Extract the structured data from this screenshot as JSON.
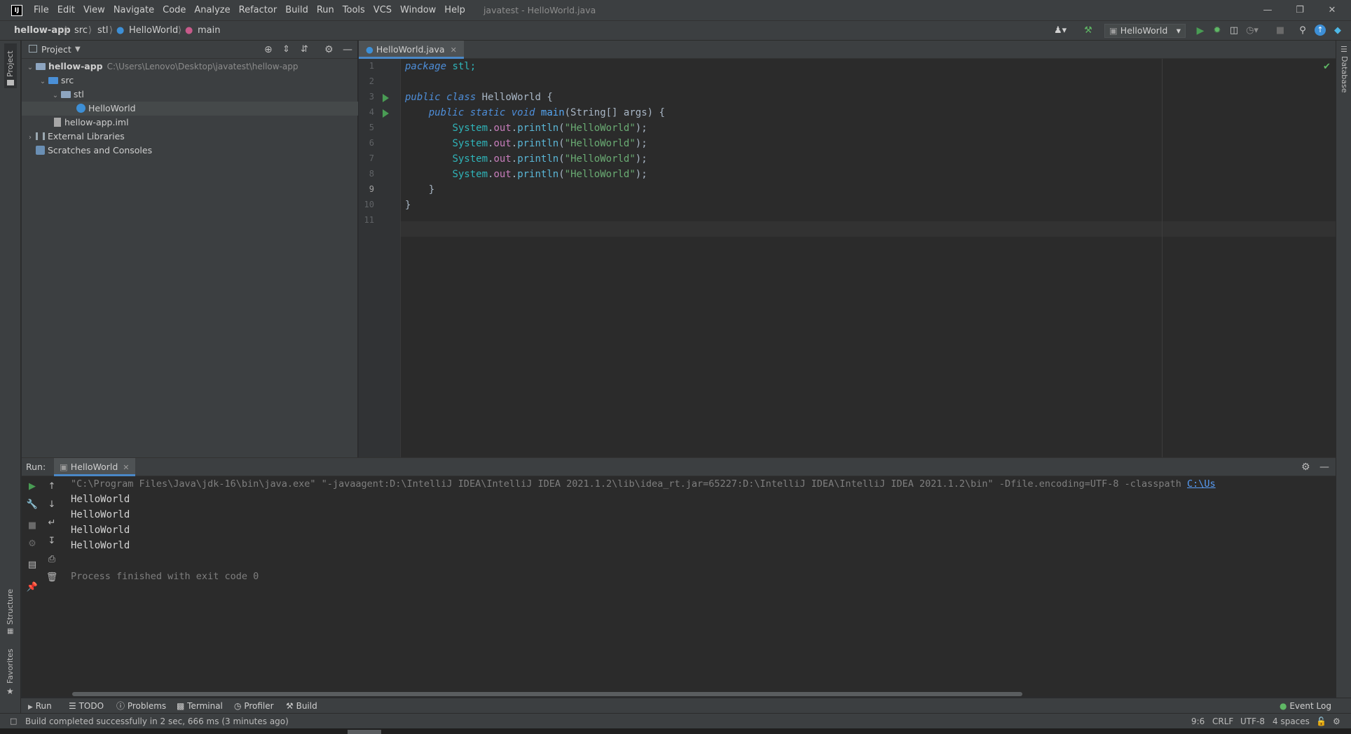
{
  "window": {
    "title": "javatest - HelloWorld.java",
    "menu": [
      "File",
      "Edit",
      "View",
      "Navigate",
      "Code",
      "Analyze",
      "Refactor",
      "Build",
      "Run",
      "Tools",
      "VCS",
      "Window",
      "Help"
    ]
  },
  "breadcrumb": {
    "project": "hellow-app",
    "src": "src",
    "pkg": "stl",
    "cls": "HelloWorld",
    "method": "main",
    "run_config": "HelloWorld"
  },
  "side": {
    "project_label": "Project",
    "structure_label": "Structure",
    "favorites_label": "Favorites",
    "database_label": "Database"
  },
  "project_panel": {
    "title": "Project",
    "tree": [
      {
        "label": "hellow-app",
        "path": "C:\\Users\\Lenovo\\Desktop\\javatest\\hellow-app"
      },
      {
        "label": "src"
      },
      {
        "label": "stl"
      },
      {
        "label": "HelloWorld"
      },
      {
        "label": "hellow-app.iml"
      },
      {
        "label": "External Libraries"
      },
      {
        "label": "Scratches and Consoles"
      }
    ]
  },
  "editor": {
    "tab": "HelloWorld.java",
    "line_numbers": [
      "1",
      "2",
      "3",
      "4",
      "5",
      "6",
      "7",
      "8",
      "9",
      "10",
      "11"
    ],
    "code": {
      "l1_kw": "package",
      "l1_rest": " stl;",
      "l3_kw1": "public",
      "l3_kw2": "class",
      "l3_rest": " HelloWorld {",
      "l4_kw1": "public",
      "l4_kw2": "static",
      "l4_kw3": "void",
      "l4_fn": "main",
      "l4_rest": "(String[] args) {",
      "sys": "System",
      "dot1": ".",
      "out": "out",
      "dot2": ".",
      "println": "println",
      "paren_open": "(",
      "str": "\"HelloWorld\"",
      "paren_close": ");",
      "l9": "    }",
      "l10": "}"
    }
  },
  "run_panel": {
    "label": "Run:",
    "tab": "HelloWorld",
    "command": "\"C:\\Program Files\\Java\\jdk-16\\bin\\java.exe\" \"-javaagent:D:\\IntelliJ IDEA\\IntelliJ IDEA 2021.1.2\\lib\\idea_rt.jar=65227:D:\\IntelliJ IDEA\\IntelliJ IDEA 2021.1.2\\bin\" -Dfile.encoding=UTF-8 -classpath",
    "command_link": "C:\\Us",
    "output": [
      "HelloWorld",
      "HelloWorld",
      "HelloWorld",
      "HelloWorld"
    ],
    "exit": "Process finished with exit code 0"
  },
  "bottom_tabs": [
    "Run",
    "TODO",
    "Problems",
    "Terminal",
    "Profiler",
    "Build"
  ],
  "event_log": "Event Log",
  "status": {
    "message": "Build completed successfully in 2 sec, 666 ms (3 minutes ago)",
    "position": "9:6",
    "line_sep": "CRLF",
    "encoding": "UTF-8",
    "indent": "4 spaces"
  },
  "colors": {
    "keyword": "#4e8ed9",
    "string": "#6aab73",
    "field": "#c77dbb",
    "run_green": "#499c54",
    "link": "#589df6"
  }
}
